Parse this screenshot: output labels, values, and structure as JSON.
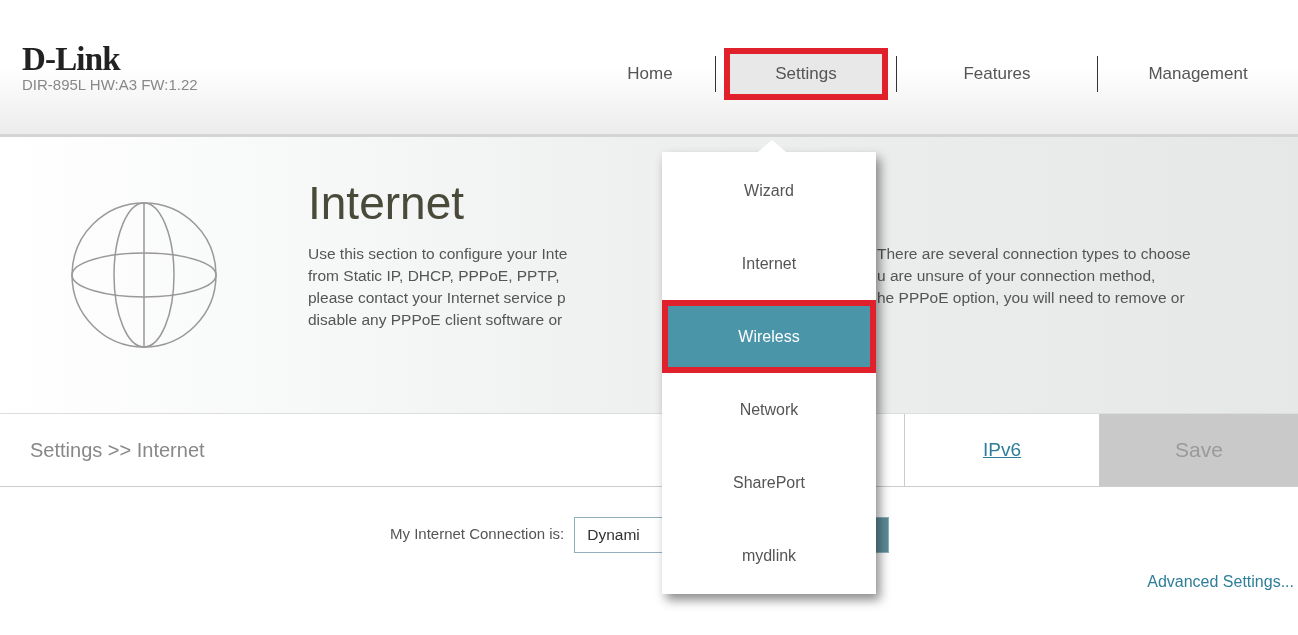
{
  "brand": {
    "logo": "D-Link",
    "model": "DIR-895L HW:A3 FW:1.22"
  },
  "nav": [
    {
      "label": "Home",
      "selected": false,
      "highlighted": false
    },
    {
      "label": "Settings",
      "selected": true,
      "highlighted": true
    },
    {
      "label": "Features",
      "selected": false,
      "highlighted": false
    },
    {
      "label": "Management",
      "selected": false,
      "highlighted": false
    }
  ],
  "dropdown": [
    {
      "label": "Wizard",
      "selected": false,
      "highlighted": false
    },
    {
      "label": "Internet",
      "selected": false,
      "highlighted": false
    },
    {
      "label": "Wireless",
      "selected": true,
      "highlighted": true
    },
    {
      "label": "Network",
      "selected": false,
      "highlighted": false
    },
    {
      "label": "SharePort",
      "selected": false,
      "highlighted": false
    },
    {
      "label": "mydlink",
      "selected": false,
      "highlighted": false
    }
  ],
  "hero": {
    "title": "Internet",
    "text_left": [
      "Use this section to configure your Inte",
      "from Static IP, DHCP, PPPoE, PPTP,",
      "please contact your Internet service p",
      "disable any PPPoE client software or"
    ],
    "text_right": [
      "There are several connection types to choose",
      "u are unsure of your connection method,",
      "he PPPoE option, you will need to remove or"
    ]
  },
  "breadcrumb": "Settings >> Internet",
  "toolbar": [
    {
      "label": "IPv6",
      "kind": "link"
    },
    {
      "label": "Save",
      "kind": "button"
    }
  ],
  "connection": {
    "label": "My Internet Connection is:",
    "value": "Dynami"
  },
  "advanced_link": "Advanced Settings..."
}
